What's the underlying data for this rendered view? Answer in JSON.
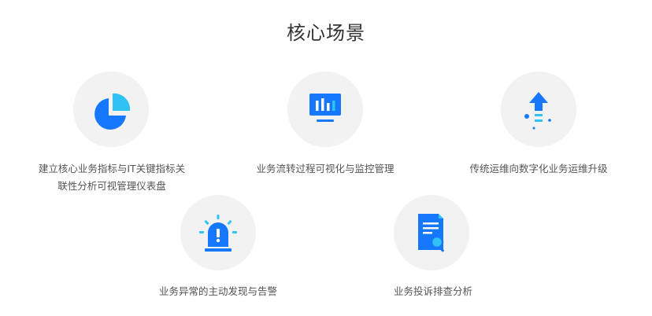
{
  "section": {
    "title": "核心场景"
  },
  "scenes": [
    {
      "icon": "pie-chart-icon",
      "lines": [
        "建立核心业务指标与IT关键指标关",
        "联性分析可视管理仪表盘"
      ]
    },
    {
      "icon": "monitor-chart-icon",
      "lines": [
        "业务流转过程可视化与监控管理"
      ]
    },
    {
      "icon": "upgrade-arrow-icon",
      "lines": [
        "传统运维向数字化业务运维升级"
      ]
    },
    {
      "icon": "alarm-light-icon",
      "lines": [
        "业务异常的主动发现与告警"
      ]
    },
    {
      "icon": "document-search-icon",
      "lines": [
        "业务投诉排查分析"
      ]
    }
  ],
  "colors": {
    "accent": "#1677ff",
    "accent_light": "#2fc3f5",
    "circle_bg": "#f2f2f2"
  }
}
